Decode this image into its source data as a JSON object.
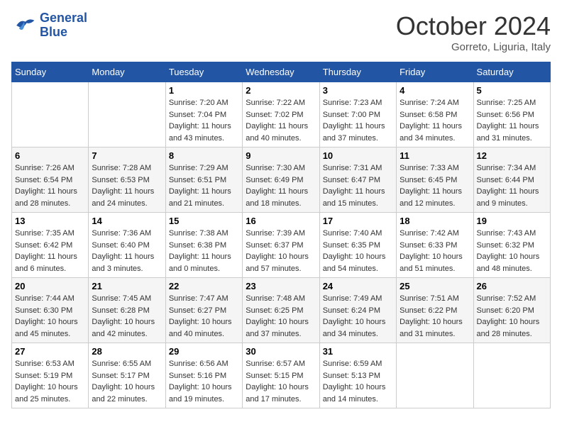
{
  "logo": {
    "line1": "General",
    "line2": "Blue"
  },
  "title": "October 2024",
  "location": "Gorreto, Liguria, Italy",
  "weekdays": [
    "Sunday",
    "Monday",
    "Tuesday",
    "Wednesday",
    "Thursday",
    "Friday",
    "Saturday"
  ],
  "weeks": [
    [
      {
        "day": "",
        "sunrise": "",
        "sunset": "",
        "daylight": ""
      },
      {
        "day": "",
        "sunrise": "",
        "sunset": "",
        "daylight": ""
      },
      {
        "day": "1",
        "sunrise": "Sunrise: 7:20 AM",
        "sunset": "Sunset: 7:04 PM",
        "daylight": "Daylight: 11 hours and 43 minutes."
      },
      {
        "day": "2",
        "sunrise": "Sunrise: 7:22 AM",
        "sunset": "Sunset: 7:02 PM",
        "daylight": "Daylight: 11 hours and 40 minutes."
      },
      {
        "day": "3",
        "sunrise": "Sunrise: 7:23 AM",
        "sunset": "Sunset: 7:00 PM",
        "daylight": "Daylight: 11 hours and 37 minutes."
      },
      {
        "day": "4",
        "sunrise": "Sunrise: 7:24 AM",
        "sunset": "Sunset: 6:58 PM",
        "daylight": "Daylight: 11 hours and 34 minutes."
      },
      {
        "day": "5",
        "sunrise": "Sunrise: 7:25 AM",
        "sunset": "Sunset: 6:56 PM",
        "daylight": "Daylight: 11 hours and 31 minutes."
      }
    ],
    [
      {
        "day": "6",
        "sunrise": "Sunrise: 7:26 AM",
        "sunset": "Sunset: 6:54 PM",
        "daylight": "Daylight: 11 hours and 28 minutes."
      },
      {
        "day": "7",
        "sunrise": "Sunrise: 7:28 AM",
        "sunset": "Sunset: 6:53 PM",
        "daylight": "Daylight: 11 hours and 24 minutes."
      },
      {
        "day": "8",
        "sunrise": "Sunrise: 7:29 AM",
        "sunset": "Sunset: 6:51 PM",
        "daylight": "Daylight: 11 hours and 21 minutes."
      },
      {
        "day": "9",
        "sunrise": "Sunrise: 7:30 AM",
        "sunset": "Sunset: 6:49 PM",
        "daylight": "Daylight: 11 hours and 18 minutes."
      },
      {
        "day": "10",
        "sunrise": "Sunrise: 7:31 AM",
        "sunset": "Sunset: 6:47 PM",
        "daylight": "Daylight: 11 hours and 15 minutes."
      },
      {
        "day": "11",
        "sunrise": "Sunrise: 7:33 AM",
        "sunset": "Sunset: 6:45 PM",
        "daylight": "Daylight: 11 hours and 12 minutes."
      },
      {
        "day": "12",
        "sunrise": "Sunrise: 7:34 AM",
        "sunset": "Sunset: 6:44 PM",
        "daylight": "Daylight: 11 hours and 9 minutes."
      }
    ],
    [
      {
        "day": "13",
        "sunrise": "Sunrise: 7:35 AM",
        "sunset": "Sunset: 6:42 PM",
        "daylight": "Daylight: 11 hours and 6 minutes."
      },
      {
        "day": "14",
        "sunrise": "Sunrise: 7:36 AM",
        "sunset": "Sunset: 6:40 PM",
        "daylight": "Daylight: 11 hours and 3 minutes."
      },
      {
        "day": "15",
        "sunrise": "Sunrise: 7:38 AM",
        "sunset": "Sunset: 6:38 PM",
        "daylight": "Daylight: 11 hours and 0 minutes."
      },
      {
        "day": "16",
        "sunrise": "Sunrise: 7:39 AM",
        "sunset": "Sunset: 6:37 PM",
        "daylight": "Daylight: 10 hours and 57 minutes."
      },
      {
        "day": "17",
        "sunrise": "Sunrise: 7:40 AM",
        "sunset": "Sunset: 6:35 PM",
        "daylight": "Daylight: 10 hours and 54 minutes."
      },
      {
        "day": "18",
        "sunrise": "Sunrise: 7:42 AM",
        "sunset": "Sunset: 6:33 PM",
        "daylight": "Daylight: 10 hours and 51 minutes."
      },
      {
        "day": "19",
        "sunrise": "Sunrise: 7:43 AM",
        "sunset": "Sunset: 6:32 PM",
        "daylight": "Daylight: 10 hours and 48 minutes."
      }
    ],
    [
      {
        "day": "20",
        "sunrise": "Sunrise: 7:44 AM",
        "sunset": "Sunset: 6:30 PM",
        "daylight": "Daylight: 10 hours and 45 minutes."
      },
      {
        "day": "21",
        "sunrise": "Sunrise: 7:45 AM",
        "sunset": "Sunset: 6:28 PM",
        "daylight": "Daylight: 10 hours and 42 minutes."
      },
      {
        "day": "22",
        "sunrise": "Sunrise: 7:47 AM",
        "sunset": "Sunset: 6:27 PM",
        "daylight": "Daylight: 10 hours and 40 minutes."
      },
      {
        "day": "23",
        "sunrise": "Sunrise: 7:48 AM",
        "sunset": "Sunset: 6:25 PM",
        "daylight": "Daylight: 10 hours and 37 minutes."
      },
      {
        "day": "24",
        "sunrise": "Sunrise: 7:49 AM",
        "sunset": "Sunset: 6:24 PM",
        "daylight": "Daylight: 10 hours and 34 minutes."
      },
      {
        "day": "25",
        "sunrise": "Sunrise: 7:51 AM",
        "sunset": "Sunset: 6:22 PM",
        "daylight": "Daylight: 10 hours and 31 minutes."
      },
      {
        "day": "26",
        "sunrise": "Sunrise: 7:52 AM",
        "sunset": "Sunset: 6:20 PM",
        "daylight": "Daylight: 10 hours and 28 minutes."
      }
    ],
    [
      {
        "day": "27",
        "sunrise": "Sunrise: 6:53 AM",
        "sunset": "Sunset: 5:19 PM",
        "daylight": "Daylight: 10 hours and 25 minutes."
      },
      {
        "day": "28",
        "sunrise": "Sunrise: 6:55 AM",
        "sunset": "Sunset: 5:17 PM",
        "daylight": "Daylight: 10 hours and 22 minutes."
      },
      {
        "day": "29",
        "sunrise": "Sunrise: 6:56 AM",
        "sunset": "Sunset: 5:16 PM",
        "daylight": "Daylight: 10 hours and 19 minutes."
      },
      {
        "day": "30",
        "sunrise": "Sunrise: 6:57 AM",
        "sunset": "Sunset: 5:15 PM",
        "daylight": "Daylight: 10 hours and 17 minutes."
      },
      {
        "day": "31",
        "sunrise": "Sunrise: 6:59 AM",
        "sunset": "Sunset: 5:13 PM",
        "daylight": "Daylight: 10 hours and 14 minutes."
      },
      {
        "day": "",
        "sunrise": "",
        "sunset": "",
        "daylight": ""
      },
      {
        "day": "",
        "sunrise": "",
        "sunset": "",
        "daylight": ""
      }
    ]
  ]
}
